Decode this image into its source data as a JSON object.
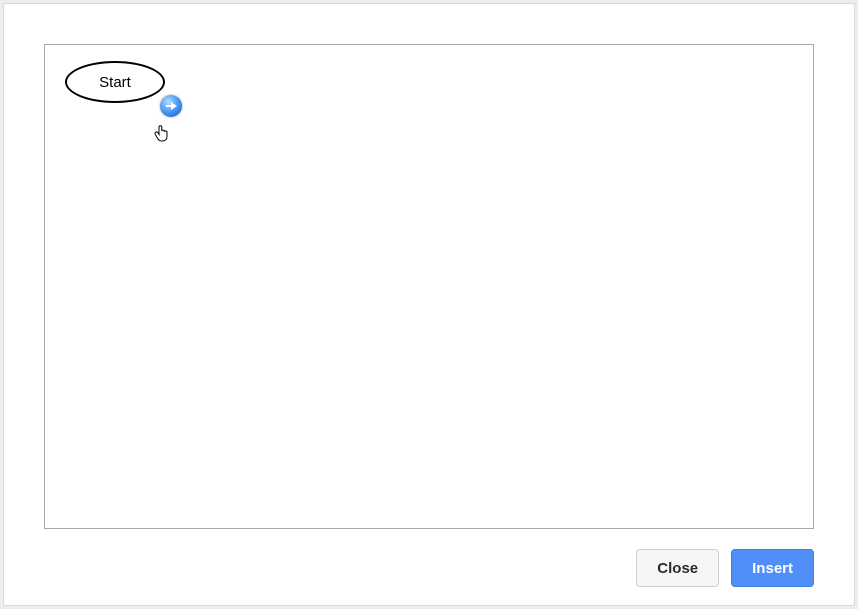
{
  "canvas": {
    "nodes": [
      {
        "label": "Start"
      }
    ]
  },
  "footer": {
    "close_label": "Close",
    "insert_label": "Insert"
  }
}
